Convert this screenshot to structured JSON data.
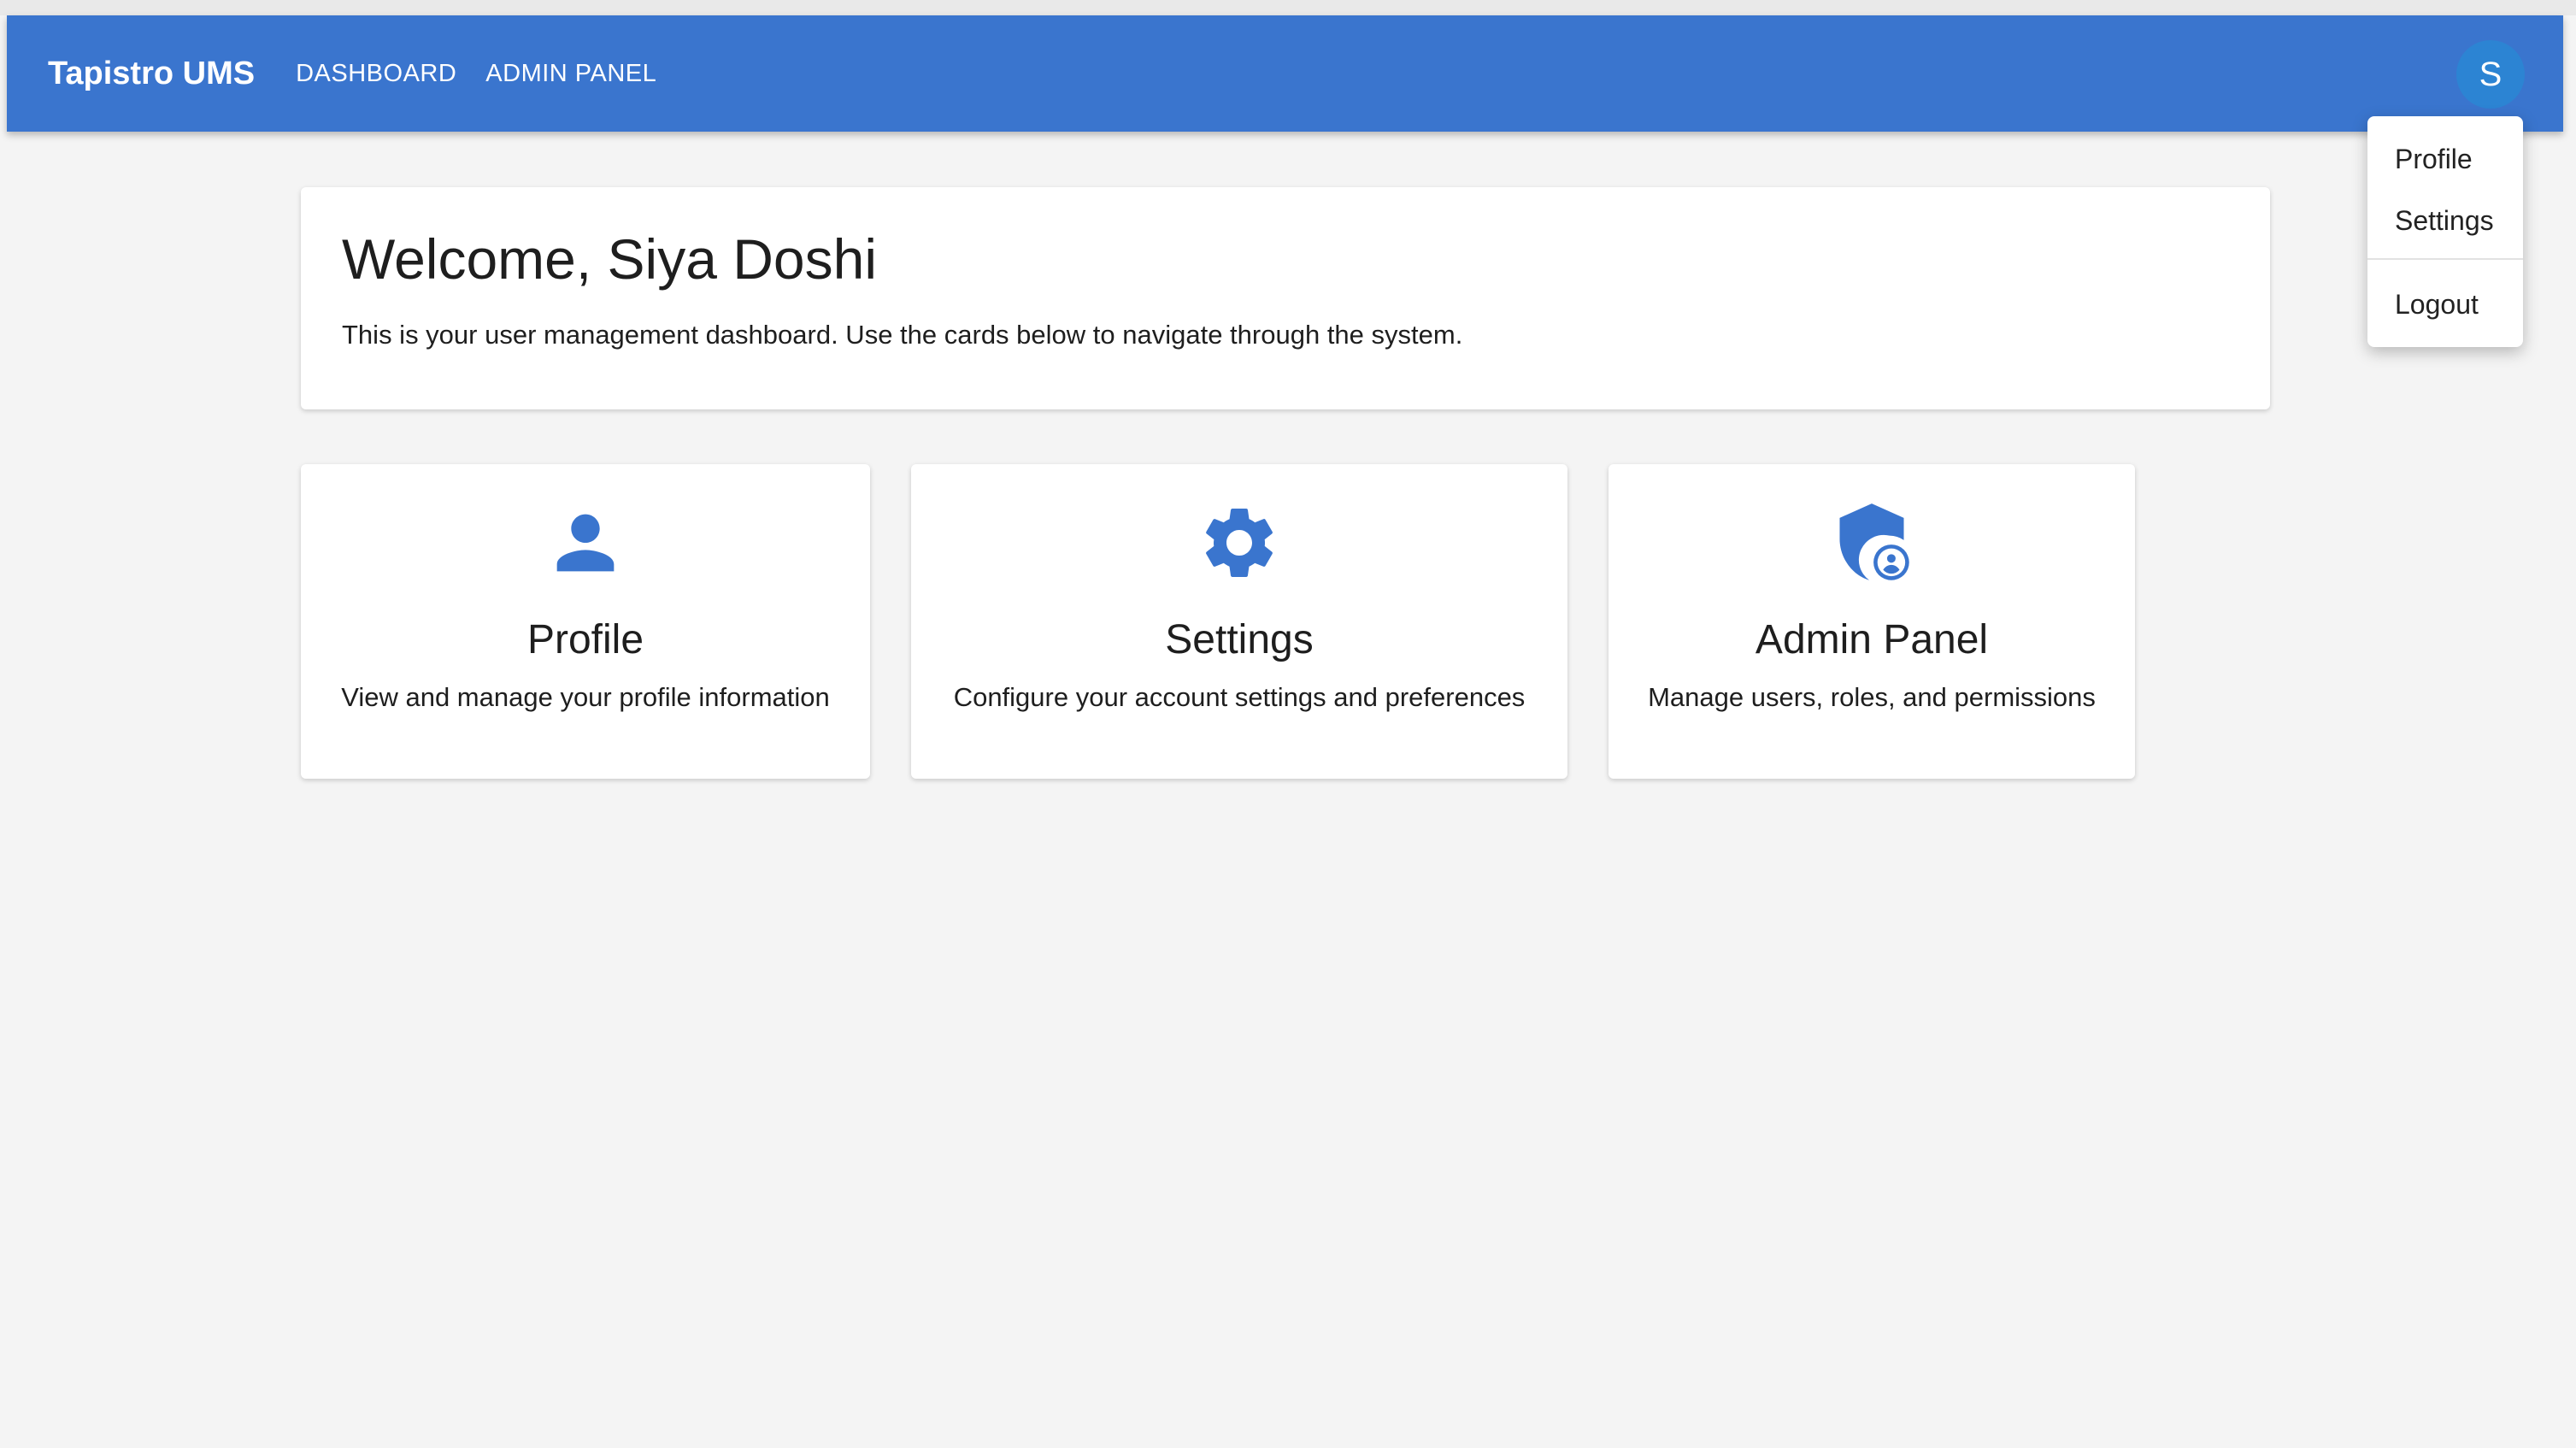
{
  "app": {
    "brand": "Tapistro UMS",
    "nav": [
      {
        "label": "DASHBOARD"
      },
      {
        "label": "ADMIN PANEL"
      }
    ],
    "avatar_initial": "S"
  },
  "account_menu": {
    "items": [
      {
        "label": "Profile"
      },
      {
        "label": "Settings"
      },
      {
        "label": "Logout"
      }
    ]
  },
  "welcome": {
    "title": "Welcome, Siya Doshi",
    "description": "This is your user management dashboard. Use the cards below to navigate through the system."
  },
  "cards": [
    {
      "icon": "person-icon",
      "title": "Profile",
      "description": "View and manage your profile information"
    },
    {
      "icon": "gear-icon",
      "title": "Settings",
      "description": "Configure your account settings and preferences"
    },
    {
      "icon": "admin-shield-icon",
      "title": "Admin Panel",
      "description": "Manage users, roles, and permissions"
    }
  ],
  "colors": {
    "primary": "#3a75ce",
    "avatar": "#2c84d3",
    "background": "#f4f4f4",
    "card": "#ffffff"
  }
}
